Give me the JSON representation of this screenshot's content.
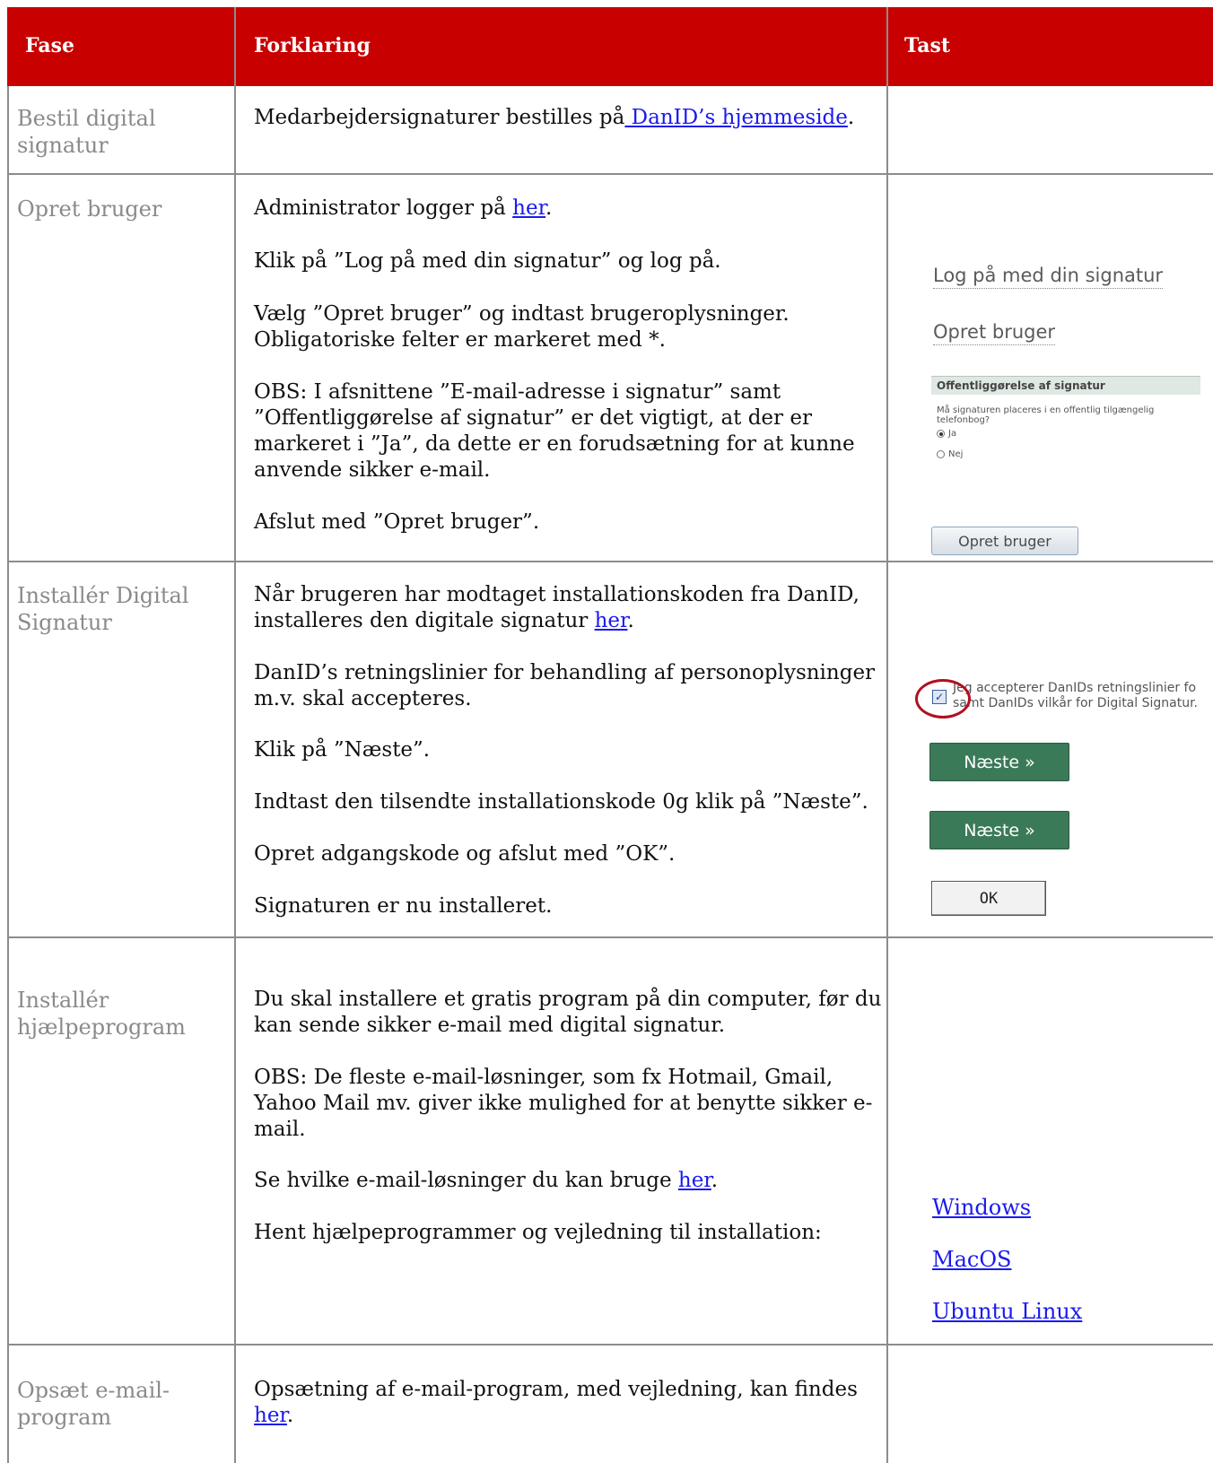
{
  "header": {
    "fase": "Fase",
    "forklaring": "Forklaring",
    "tast": "Tast"
  },
  "rows": [
    {
      "fase": "Bestil digital signatur",
      "paras": [
        {
          "pre": "Medarbejdersignaturer bestilles på",
          "link": " DanID’s hjemmeside",
          "post": "."
        }
      ]
    },
    {
      "fase": "Opret bruger",
      "paras": [
        {
          "pre": "Administrator logger på ",
          "link": "her",
          "post": "."
        },
        {
          "pre": "Klik på ”Log på med din signatur” og log på."
        },
        {
          "pre": "Vælg ”Opret bruger” og indtast brugeroplysninger. Obligatoriske felter er markeret med *."
        },
        {
          "pre": "OBS: I afsnittene ”E-mail-adresse i signatur” samt ”Offentliggørelse af signatur” er det vigtigt, at der er markeret i ”Ja”, da dette er en forudsætning for at kunne anvende sikker e-mail."
        },
        {
          "pre": "Afslut med ”Opret bruger”."
        }
      ],
      "tast": {
        "log_pa_label": "Log på med din signatur",
        "opret_bruger_label": "Opret bruger",
        "offentlig_title": "Offentliggørelse af signatur",
        "offentlig_question": "Må signaturen placeres i en offentlig tilgængelig telefonbog?",
        "opt_ja": "Ja",
        "opt_nej": "Nej",
        "opret_button": "Opret bruger"
      }
    },
    {
      "fase": "Installér Digital Signatur",
      "paras": [
        {
          "pre": "Når brugeren har modtaget installationskoden fra DanID, installeres den digitale signatur ",
          "link": "her",
          "post": "."
        },
        {
          "pre": "DanID’s retningslinier for behandling af personoplysninger m.v. skal accepteres."
        },
        {
          "pre": "Klik på ”Næste”."
        },
        {
          "pre": "Indtast den tilsendte installationskode 0g klik på ”Næste”."
        },
        {
          "pre": "Opret adgangskode og afslut med ”OK”."
        },
        {
          "pre": "Signaturen er nu installeret."
        }
      ],
      "tast": {
        "accept_line1": "Jeg accepterer DanIDs retningslinier fo",
        "accept_line2": "samt DanIDs vilkår for Digital Signatur.",
        "naeste1": "Næste »",
        "naeste2": "Næste »",
        "ok": "OK"
      }
    },
    {
      "fase": "Installér hjælpeprogram",
      "paras": [
        {
          "pre": "Du skal installere et gratis program på din computer, før du kan sende sikker e-mail med digital signatur."
        },
        {
          "pre": "OBS: De fleste e-mail-løsninger, som fx Hotmail, Gmail, Yahoo Mail mv. giver ikke mulighed for at benytte sikker e-mail."
        },
        {
          "pre": "Se hvilke e-mail-løsninger du kan bruge ",
          "link": "her",
          "post": "."
        },
        {
          "pre": "Hent hjælpeprogrammer og vejledning til installation:"
        }
      ],
      "tast": {
        "links": [
          "Windows",
          "MacOS",
          "Ubuntu Linux"
        ]
      }
    },
    {
      "fase": "Opsæt e-mail-program",
      "paras": [
        {
          "pre": "Opsætning af e-mail-program, med vejledning, kan findes ",
          "link": "her",
          "post": "."
        }
      ]
    }
  ]
}
